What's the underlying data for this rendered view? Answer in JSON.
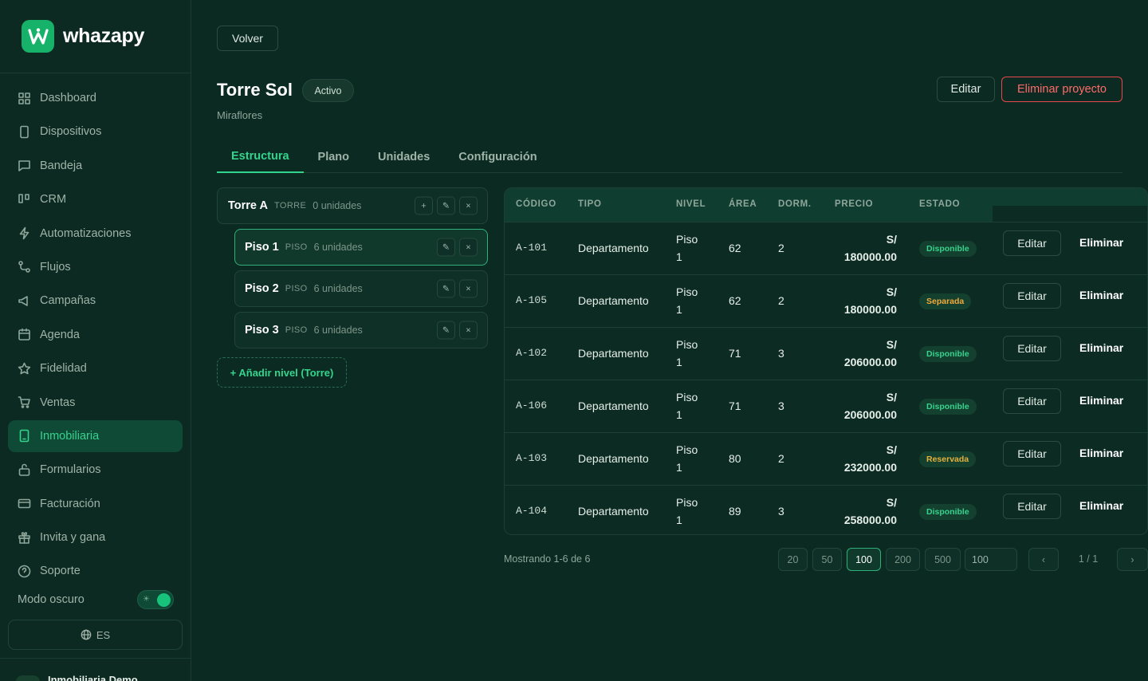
{
  "brand": {
    "name": "whazapy"
  },
  "sidebar": {
    "items": [
      {
        "label": "Dashboard",
        "icon": "grid-icon"
      },
      {
        "label": "Dispositivos",
        "icon": "phone-icon"
      },
      {
        "label": "Bandeja",
        "icon": "chat-icon"
      },
      {
        "label": "CRM",
        "icon": "kanban-icon"
      },
      {
        "label": "Automatizaciones",
        "icon": "bolt-icon"
      },
      {
        "label": "Flujos",
        "icon": "flow-icon"
      },
      {
        "label": "Campañas",
        "icon": "megaphone-icon"
      },
      {
        "label": "Agenda",
        "icon": "calendar-icon"
      },
      {
        "label": "Fidelidad",
        "icon": "star-icon"
      },
      {
        "label": "Ventas",
        "icon": "cart-icon"
      },
      {
        "label": "Inmobiliaria",
        "icon": "building-icon",
        "active": true
      },
      {
        "label": "Formularios",
        "icon": "form-icon"
      },
      {
        "label": "Facturación",
        "icon": "card-icon"
      },
      {
        "label": "Invita y gana",
        "icon": "gift-icon"
      },
      {
        "label": "Soporte",
        "icon": "help-icon"
      }
    ],
    "dark_mode_label": "Modo oscuro",
    "dark_mode_on": true,
    "language": "ES",
    "account_name": "Inmobiliaria Demo"
  },
  "header": {
    "back_label": "Volver",
    "title": "Torre Sol",
    "status": "Activo",
    "subtitle": "Miraflores",
    "edit_label": "Editar",
    "delete_label": "Eliminar proyecto"
  },
  "tabs": [
    {
      "label": "Estructura",
      "active": true
    },
    {
      "label": "Plano"
    },
    {
      "label": "Unidades"
    },
    {
      "label": "Configuración"
    }
  ],
  "tree": {
    "tower": {
      "name": "Torre A",
      "kind": "TORRE",
      "count": "0 unidades"
    },
    "floors": [
      {
        "name": "Piso 1",
        "kind": "PISO",
        "count": "6 unidades",
        "selected": true
      },
      {
        "name": "Piso 2",
        "kind": "PISO",
        "count": "6 unidades"
      },
      {
        "name": "Piso 3",
        "kind": "PISO",
        "count": "6 unidades"
      }
    ],
    "add_label": "+ Añadir nivel (Torre)",
    "add_glyph": "+",
    "edit_glyph": "✎",
    "remove_glyph": "×"
  },
  "table": {
    "columns": [
      "CÓDIGO",
      "TIPO",
      "NIVEL",
      "ÁREA",
      "DORM.",
      "PRECIO",
      "ESTADO"
    ],
    "rows": [
      {
        "code": "A-101",
        "type": "Departamento",
        "level_a": "Piso",
        "level_b": "1",
        "area": "62",
        "beds": "2",
        "price_a": "S/",
        "price_b": "180000.00",
        "status": "Disponible",
        "status_kind": "disp"
      },
      {
        "code": "A-105",
        "type": "Departamento",
        "level_a": "Piso",
        "level_b": "1",
        "area": "62",
        "beds": "2",
        "price_a": "S/",
        "price_b": "180000.00",
        "status": "Separada",
        "status_kind": "sep"
      },
      {
        "code": "A-102",
        "type": "Departamento",
        "level_a": "Piso",
        "level_b": "1",
        "area": "71",
        "beds": "3",
        "price_a": "S/",
        "price_b": "206000.00",
        "status": "Disponible",
        "status_kind": "disp"
      },
      {
        "code": "A-106",
        "type": "Departamento",
        "level_a": "Piso",
        "level_b": "1",
        "area": "71",
        "beds": "3",
        "price_a": "S/",
        "price_b": "206000.00",
        "status": "Disponible",
        "status_kind": "disp"
      },
      {
        "code": "A-103",
        "type": "Departamento",
        "level_a": "Piso",
        "level_b": "1",
        "area": "80",
        "beds": "2",
        "price_a": "S/",
        "price_b": "232000.00",
        "status": "Reservada",
        "status_kind": "res"
      },
      {
        "code": "A-104",
        "type": "Departamento",
        "level_a": "Piso",
        "level_b": "1",
        "area": "89",
        "beds": "3",
        "price_a": "S/",
        "price_b": "258000.00",
        "status": "Disponible",
        "status_kind": "disp"
      }
    ],
    "edit_label": "Editar",
    "delete_label": "Eliminar"
  },
  "pagination": {
    "showing": "Mostrando 1-6 de 6",
    "sizes": [
      "20",
      "50",
      "100",
      "200",
      "500"
    ],
    "active_size": "100",
    "custom_size": "100",
    "prev": "‹",
    "next": "›",
    "page_info": "1 / 1"
  },
  "colors": {
    "background": "#0b2a21",
    "accent": "#35d48e",
    "danger": "#e5484d",
    "warning": "#f2a93b"
  }
}
